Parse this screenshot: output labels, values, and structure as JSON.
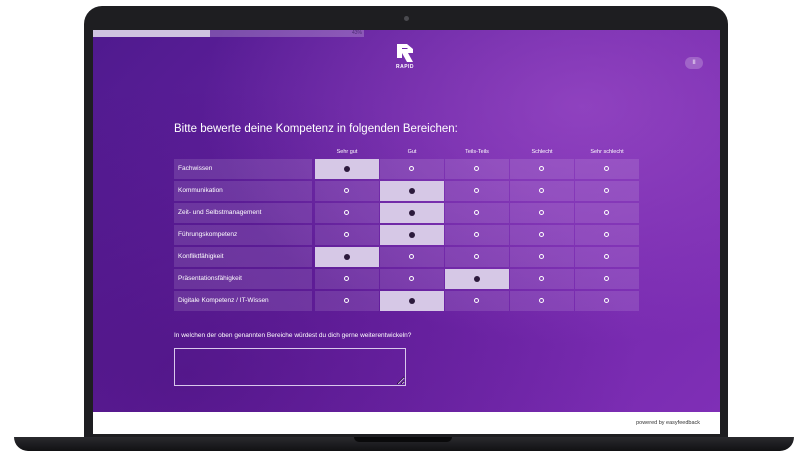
{
  "progress": {
    "percent": 43,
    "label": "43%"
  },
  "brand": {
    "name": "RAPID"
  },
  "header": {
    "pause_icon": "pause-icon",
    "pause_label": "II"
  },
  "question1": {
    "title": "Bitte bewerte deine Kompetenz in folgenden Bereichen:",
    "columns": [
      "Sehr gut",
      "Gut",
      "Teils-Teils",
      "Schlecht",
      "Sehr schlecht"
    ],
    "rows": [
      {
        "label": "Fachwissen",
        "selected": 0
      },
      {
        "label": "Kommunikation",
        "selected": 1
      },
      {
        "label": "Zeit- und Selbstmanagement",
        "selected": 1
      },
      {
        "label": "Führungskompetenz",
        "selected": 1
      },
      {
        "label": "Konfliktfähigkeit",
        "selected": 0
      },
      {
        "label": "Präsentationsfähigkeit",
        "selected": 2
      },
      {
        "label": "Digitale Kompetenz / IT-Wissen",
        "selected": 1
      }
    ]
  },
  "question2": {
    "title": "In welchen der oben genannten Bereiche würdest du dich gerne weiterentwickeln?",
    "value": "",
    "placeholder": ""
  },
  "footer": {
    "powered_by": "powered by easyfeedback"
  },
  "colors": {
    "accent": "#6e24a8",
    "selected_cell": "#d6c8e6"
  }
}
